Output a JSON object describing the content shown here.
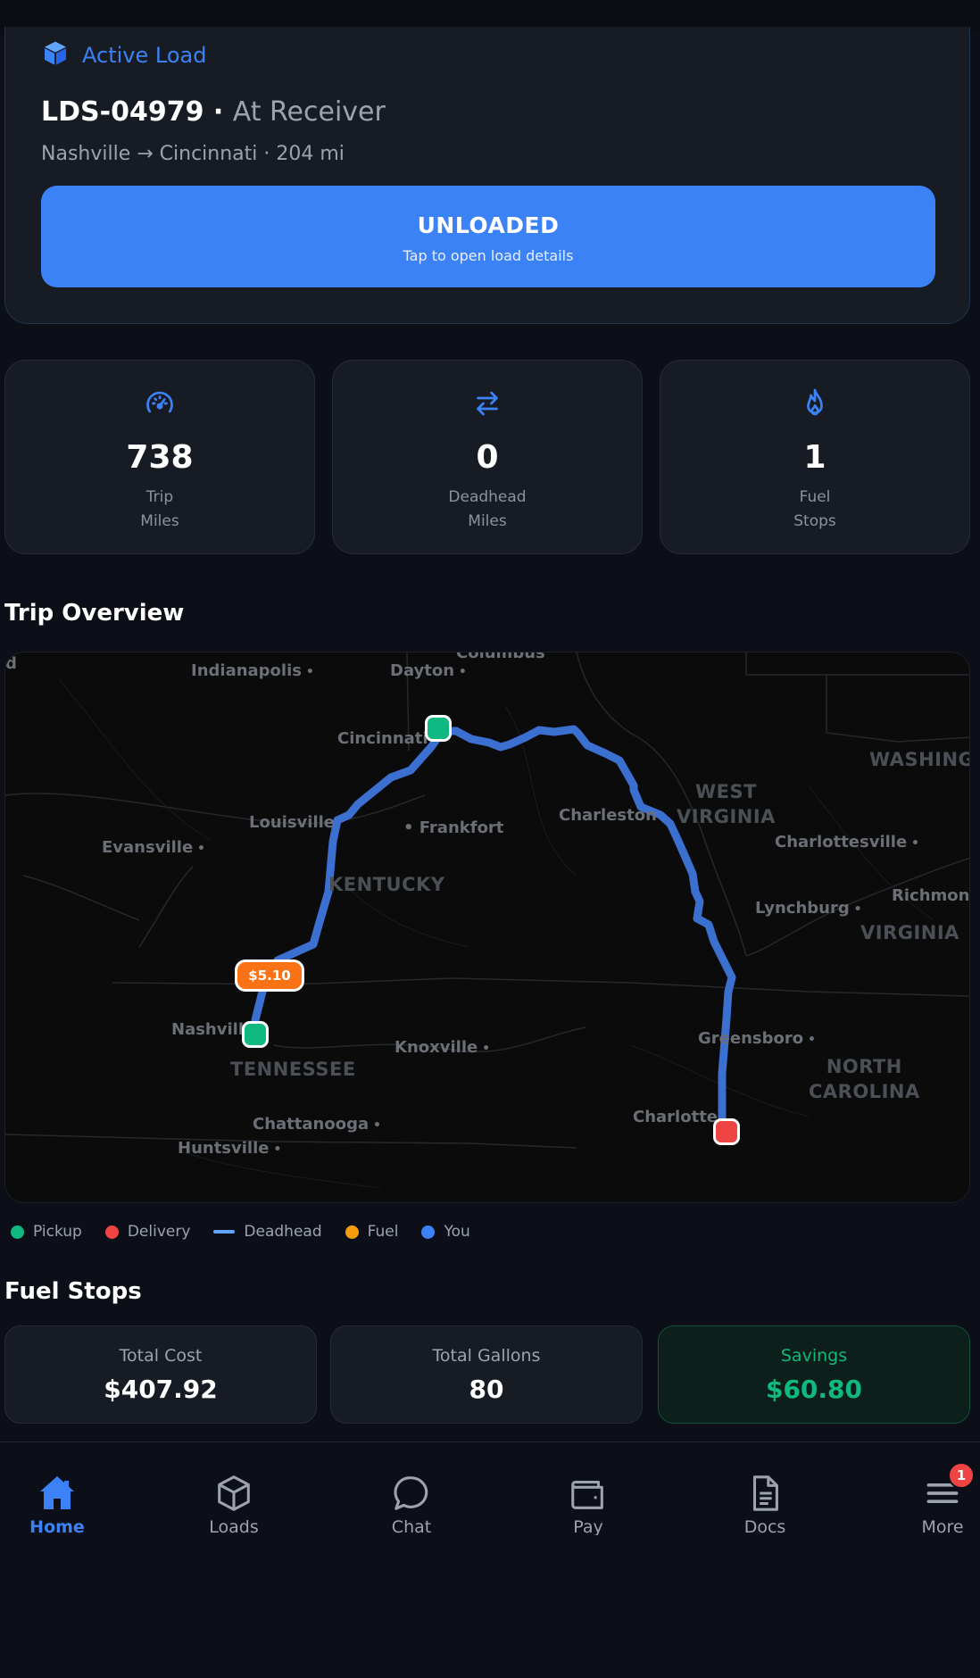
{
  "active_load": {
    "section_label": "Active Load",
    "load_id": "LDS-04979",
    "separator": " · ",
    "status": "At Receiver",
    "route": "Nashville → Cincinnati · 204 mi",
    "action_label": "UNLOADED",
    "action_hint": "Tap to open load details"
  },
  "stats": [
    {
      "icon": "speedometer-icon",
      "value": "738",
      "label_1": "Trip",
      "label_2": "Miles"
    },
    {
      "icon": "swap-arrows-icon",
      "value": "0",
      "label_1": "Deadhead",
      "label_2": "Miles"
    },
    {
      "icon": "flame-icon",
      "value": "1",
      "label_1": "Fuel",
      "label_2": "Stops"
    }
  ],
  "trip_overview": {
    "title": "Trip Overview",
    "fuel_price": "$5.10",
    "cities": {
      "columbus": "Columbus",
      "indianapolis": "Indianapolis",
      "dayton": "Dayton",
      "cincinnati": "Cincinnati",
      "louisville": "Louisville",
      "frankfort": "Frankfort",
      "evansville": "Evansville",
      "charleston": "Charleston",
      "charlottesville": "Charlottesville",
      "richmond": "Richmon",
      "lynchburg": "Lynchburg",
      "nashville": "Nashville",
      "knoxville": "Knoxville",
      "greensboro": "Greensboro",
      "charlotte": "Charlotte",
      "chattanooga": "Chattanooga",
      "huntsville": "Huntsville"
    },
    "states": {
      "kentucky": "KENTUCKY",
      "tennessee": "TENNESSEE",
      "west_virginia_1": "WEST",
      "west_virginia_2": "VIRGINIA",
      "virginia": "VIRGINIA",
      "north_carolina_1": "NORTH",
      "north_carolina_2": "CAROLINA",
      "washington": "WASHINGTO"
    },
    "legend": [
      {
        "label": "Pickup",
        "color": "#10b981",
        "kind": "dot"
      },
      {
        "label": "Delivery",
        "color": "#ef4444",
        "kind": "dot"
      },
      {
        "label": "Deadhead",
        "color": "#60a5fa",
        "kind": "line"
      },
      {
        "label": "Fuel",
        "color": "#f59e0b",
        "kind": "dot"
      },
      {
        "label": "You",
        "color": "#3b82f6",
        "kind": "dot"
      }
    ]
  },
  "fuel_stops": {
    "title": "Fuel Stops",
    "total_cost_label": "Total Cost",
    "total_cost": "$407.92",
    "total_gallons_label": "Total Gallons",
    "total_gallons": "80",
    "savings_label": "Savings",
    "savings": "$60.80"
  },
  "nav": {
    "home": "Home",
    "loads": "Loads",
    "chat": "Chat",
    "pay": "Pay",
    "docs": "Docs",
    "more": "More",
    "more_badge": "1"
  },
  "colors": {
    "accent": "#3b82f6",
    "pickup": "#10b981",
    "delivery": "#ef4444",
    "fuel_tag": "#f97316"
  }
}
